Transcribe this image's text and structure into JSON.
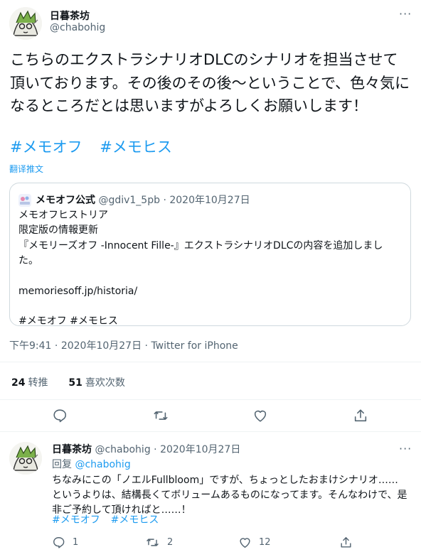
{
  "tweet": {
    "author_name": "日暮茶坊",
    "author_handle": "@chabohig",
    "more_label": "···",
    "text": "こちらのエクストラシナリオDLCのシナリオを担当させて頂いております。その後のその後～ということで、色々気になるところだとは思いますがよろしくお願いします！",
    "hashtags": [
      "#メモオフ",
      "#メモヒス"
    ],
    "translate_label": "翻译推文",
    "quote": {
      "author_name": "メモオフ公式",
      "author_handle": "@gdiv1_5pb",
      "separator": "·",
      "date": "2020年10月27日",
      "lines": [
        "メモオフヒストリア",
        "限定版の情報更新",
        "『メモリーズオフ -Innocent Fille-』エクストラシナリオDLCの内容を追加しまし",
        "た。",
        "",
        "memoriesoff.jp/historia/",
        "",
        "#メモオフ #メモヒス"
      ]
    },
    "time": "下午9:41",
    "date": "2020年10月27日",
    "source": "Twitter for iPhone",
    "retweets_count": "24",
    "retweets_label": "转推",
    "likes_count": "51",
    "likes_label": "喜欢次数"
  },
  "reply": {
    "author_name": "日暮茶坊",
    "author_handle": "@chabohig",
    "separator": "·",
    "date": "2020年10月27日",
    "replying_label": "回复",
    "replying_to": "@chabohig",
    "text": "ちなみにこの「ノエルFullbloom」ですが、ちょっとしたおまけシナリオ……というよりは、結構長くてボリュームあるものになってます。そんなわけで、是非ご予約して頂ければと……！",
    "hashtags": [
      "#メモオフ",
      "#メモヒス"
    ],
    "reply_count": "1",
    "retweet_count": "2",
    "like_count": "12"
  },
  "icons": [
    "reply-icon",
    "retweet-icon",
    "like-icon",
    "share-icon",
    "more-icon"
  ],
  "colors": {
    "link": "#1d9bf0",
    "secondary": "#536471",
    "border": "#cfd9de"
  }
}
